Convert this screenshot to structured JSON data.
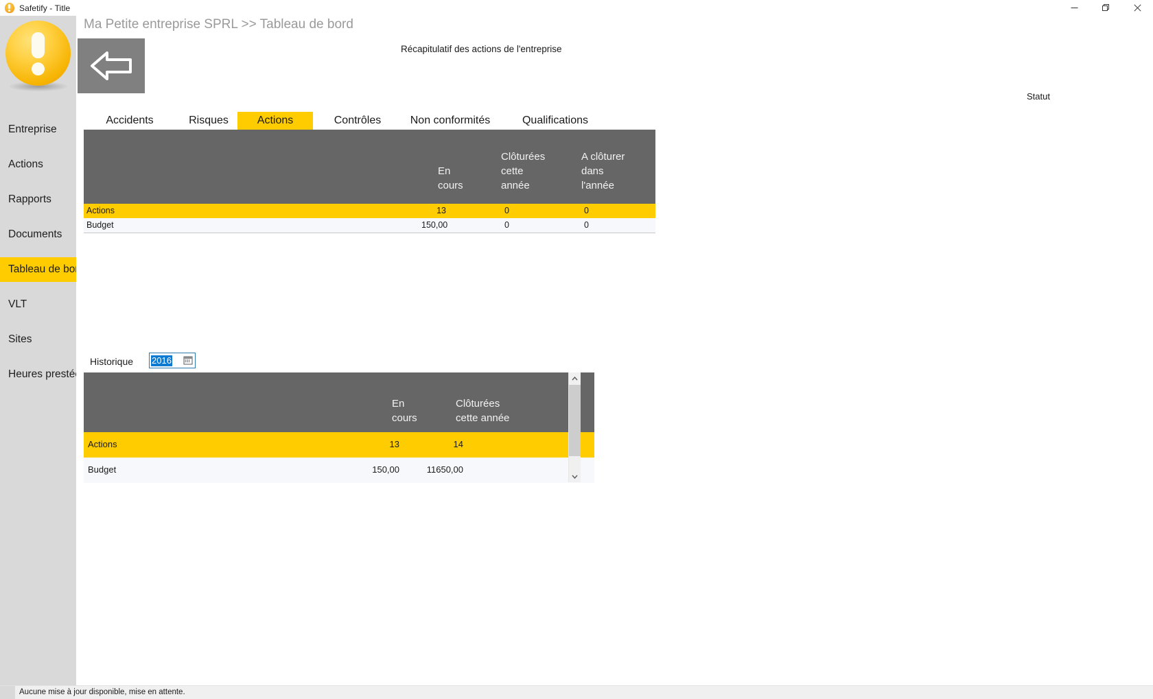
{
  "window": {
    "title": "Safetify - Title",
    "app_icon": "lightbulb-icon",
    "minimize_label": "Minimize",
    "maximize_label": "Restore",
    "close_label": "Close"
  },
  "sidebar": {
    "logo_name": "safetify-logo",
    "items": [
      {
        "label": "Entreprise",
        "active": false
      },
      {
        "label": "Actions",
        "active": false
      },
      {
        "label": "Rapports",
        "active": false
      },
      {
        "label": "Documents",
        "active": false
      },
      {
        "label": "Tableau de bord",
        "active": true
      },
      {
        "label": "VLT",
        "active": false
      },
      {
        "label": "Sites",
        "active": false
      },
      {
        "label": "Heures prestées",
        "active": false
      }
    ]
  },
  "header": {
    "breadcrumb": "Ma Petite entreprise SPRL >> Tableau de bord",
    "back_button": "back-arrow-icon",
    "subtitle": "Récapitulatif des actions de l'entreprise",
    "statut_label": "Statut"
  },
  "tabs": [
    {
      "label": "Accidents",
      "active": false
    },
    {
      "label": "Risques",
      "active": false
    },
    {
      "label": "Actions",
      "active": true
    },
    {
      "label": "Contrôles",
      "active": false
    },
    {
      "label": "Non conformités",
      "active": false
    },
    {
      "label": "Qualifications",
      "active": false
    }
  ],
  "summary_table": {
    "columns": [
      "",
      "En cours",
      "Clôturées cette année",
      "A clôturer dans l'année"
    ],
    "rows": [
      {
        "label": "Actions",
        "values": [
          "13",
          "0",
          "0"
        ],
        "selected": true
      },
      {
        "label": "Budget",
        "values": [
          "150,00",
          "0",
          "0"
        ],
        "selected": false
      }
    ]
  },
  "historique": {
    "label": "Historique",
    "year_value": "2016",
    "calendar_icon": "calendar-icon",
    "table": {
      "columns": [
        "",
        "En cours",
        "Clôturées cette année"
      ],
      "rows": [
        {
          "label": "Actions",
          "values": [
            "13",
            "14"
          ],
          "selected": true
        },
        {
          "label": "Budget",
          "values": [
            "150,00",
            "11650,00"
          ],
          "selected": false
        }
      ]
    },
    "scrollbar": {
      "up_icon": "chevron-up-icon",
      "down_icon": "chevron-down-icon"
    }
  },
  "statusbar": {
    "message": "Aucune mise à jour disponible, mise en attente."
  },
  "colors": {
    "accent": "#ffcc00",
    "header_gray": "#666666",
    "sidebar": "#d9d9d9",
    "selection_blue": "#0b7ad1"
  }
}
